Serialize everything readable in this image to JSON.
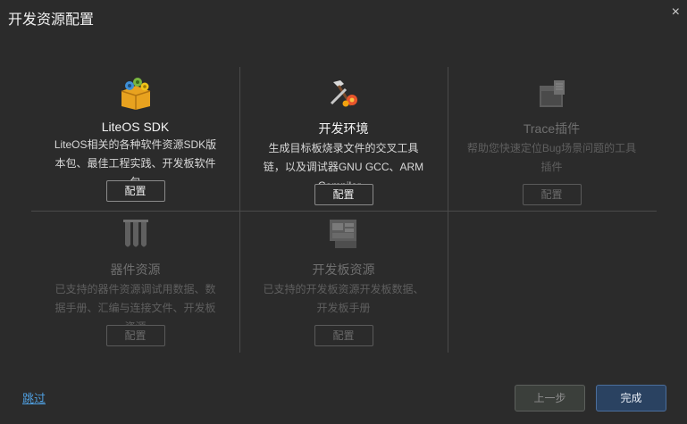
{
  "dialog": {
    "title": "开发资源配置",
    "close_symbol": "×"
  },
  "cards": [
    {
      "name": "LiteOS SDK",
      "desc": "LiteOS相关的各种软件资源SDK版本包、最佳工程实践、开发板软件包",
      "button": "配置",
      "enabled": true,
      "icon": "gears-box-icon"
    },
    {
      "name": "开发环境",
      "desc": "生成目标板烧录文件的交叉工具链，以及调试器GNU GCC、ARM Compiler...",
      "button": "配置",
      "enabled": true,
      "icon": "tools-gear-icon"
    },
    {
      "name": "Trace插件",
      "desc": "帮助您快速定位Bug场景问题的工具插件",
      "button": "配置",
      "enabled": false,
      "icon": "trace-window-icon"
    },
    {
      "name": "器件资源",
      "desc": "已支持的器件资源调试用数据、数据手册、汇编与连接文件、开发板资源",
      "button": "配置",
      "enabled": false,
      "icon": "test-tubes-icon"
    },
    {
      "name": "开发板资源",
      "desc": "已支持的开发板资源开发板数据、开发板手册",
      "button": "配置",
      "enabled": false,
      "icon": "board-icon"
    }
  ],
  "footer": {
    "skip": "跳过",
    "prev": "上一步",
    "finish": "完成"
  }
}
